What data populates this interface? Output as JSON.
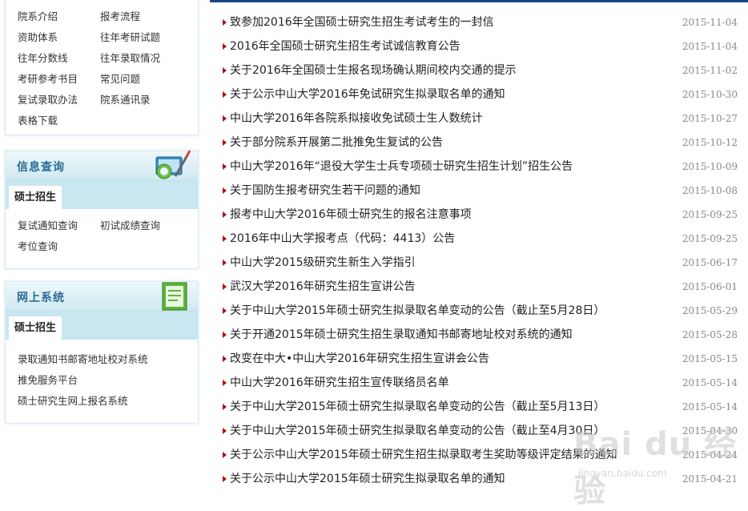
{
  "sidebar": {
    "top_links": [
      "院系介绍",
      "报考流程",
      "资助体系",
      "往年考研试题",
      "往年分数线",
      "往年录取情况",
      "考研参考书目",
      "常见问题",
      "复试录取办法",
      "院系通讯录"
    ],
    "extra_link": "表格下载",
    "info_query": {
      "title": "信息查询",
      "tab": "硕士招生",
      "links": [
        "复试通知查询",
        "初试成绩查询",
        "考位查询"
      ]
    },
    "online_system": {
      "title": "网上系统",
      "tab": "硕士招生",
      "links": [
        "录取通知书邮寄地址校对系统",
        "推免服务平台",
        "硕士研究生网上报名系统"
      ]
    }
  },
  "news": [
    {
      "title": "致参加2016年全国硕士研究生招生考试考生的一封信",
      "date": "2015-11-04"
    },
    {
      "title": "2016年全国硕士研究生招生考试诚信教育公告",
      "date": "2015-11-04"
    },
    {
      "title": "关于2016年全国硕士生报名现场确认期间校内交通的提示",
      "date": "2015-11-02"
    },
    {
      "title": "关于公示中山大学2016年免试研究生拟录取名单的通知",
      "date": "2015-10-30"
    },
    {
      "title": "中山大学2016年各院系拟接收免试硕士生人数统计",
      "date": "2015-10-27"
    },
    {
      "title": "关于部分院系开展第二批推免生复试的公告",
      "date": "2015-10-12"
    },
    {
      "title": "中山大学2016年“退役大学生士兵专项硕士研究生招生计划”招生公告",
      "date": "2015-10-09"
    },
    {
      "title": "关于国防生报考研究生若干问题的通知",
      "date": "2015-10-08"
    },
    {
      "title": "报考中山大学2016年硕士研究生的报名注意事项",
      "date": "2015-09-25"
    },
    {
      "title": "2016年中山大学报考点（代码：4413）公告",
      "date": "2015-09-25"
    },
    {
      "title": "中山大学2015级研究生新生入学指引",
      "date": "2015-06-17"
    },
    {
      "title": "武汉大学2016年研究生招生宣讲公告",
      "date": "2015-06-01"
    },
    {
      "title": "关于中山大学2015年硕士研究生拟录取名单变动的公告（截止至5月28日）",
      "date": "2015-05-29"
    },
    {
      "title": "关于开通2015年硕士研究生招生录取通知书邮寄地址校对系统的通知",
      "date": "2015-05-28"
    },
    {
      "title": "改变在中大•中山大学2016年研究生招生宣讲会公告",
      "date": "2015-05-15"
    },
    {
      "title": "中山大学2016年研究生招生宣传联络员名单",
      "date": "2015-05-14"
    },
    {
      "title": "关于中山大学2015年硕士研究生拟录取名单变动的公告（截止至5月13日）",
      "date": "2015-05-14"
    },
    {
      "title": "关于中山大学2015年硕士研究生拟录取名单变动的公告（截止至4月30日）",
      "date": "2015-04-30"
    },
    {
      "title": "关于公示中山大学2015年硕士研究生招生拟录取考生奖助等级评定结果的通知",
      "date": "2015-04-24"
    },
    {
      "title": "关于公示中山大学2015年硕士研究生拟录取名单的通知",
      "date": "2015-04-21"
    }
  ],
  "watermark": {
    "brand": "Bai du 经验",
    "url": "jingyan.baidu.com"
  },
  "colors": {
    "accent": "#1a4a86",
    "arrow": "#b01010",
    "title_blue": "#2a6c95"
  }
}
